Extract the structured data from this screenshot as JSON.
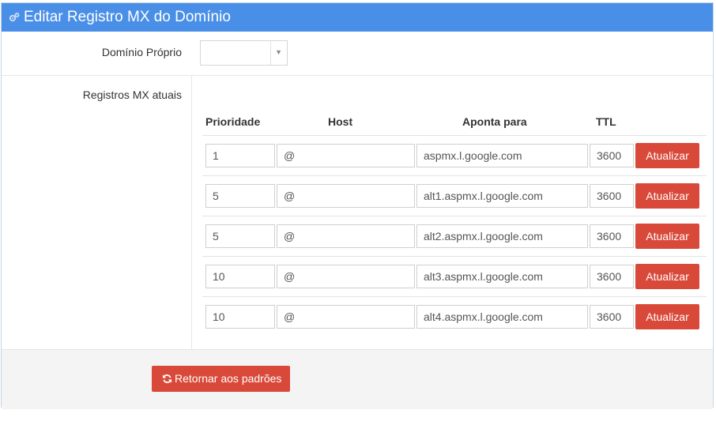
{
  "header": {
    "title": "Editar Registro MX do Domínio",
    "icon": "gears-icon"
  },
  "domain": {
    "label": "Domínio Próprio",
    "value": ""
  },
  "mx_section": {
    "label": "Registros MX atuais",
    "columns": {
      "priority": "Prioridade",
      "host": "Host",
      "points_to": "Aponta para",
      "ttl": "TTL"
    },
    "rows": [
      {
        "priority": "1",
        "host": "@",
        "points_to": "aspmx.l.google.com",
        "ttl": "3600",
        "action": "Atualizar"
      },
      {
        "priority": "5",
        "host": "@",
        "points_to": "alt1.aspmx.l.google.com",
        "ttl": "3600",
        "action": "Atualizar"
      },
      {
        "priority": "5",
        "host": "@",
        "points_to": "alt2.aspmx.l.google.com",
        "ttl": "3600",
        "action": "Atualizar"
      },
      {
        "priority": "10",
        "host": "@",
        "points_to": "alt3.aspmx.l.google.com",
        "ttl": "3600",
        "action": "Atualizar"
      },
      {
        "priority": "10",
        "host": "@",
        "points_to": "alt4.aspmx.l.google.com",
        "ttl": "3600",
        "action": "Atualizar"
      }
    ]
  },
  "footer": {
    "reset_label": "Retornar aos padrões",
    "reset_icon": "refresh-icon"
  },
  "colors": {
    "header": "#4a8fe7",
    "danger": "#d9493a"
  }
}
